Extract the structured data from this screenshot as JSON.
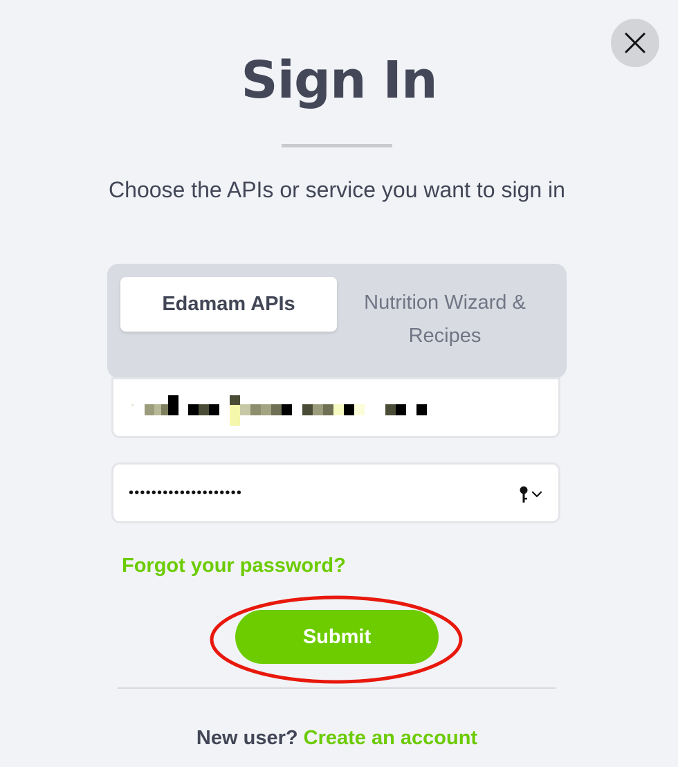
{
  "dialog": {
    "close_icon": "close-icon",
    "title": "Sign In",
    "subtitle": "Choose the APIs or service you want to sign in"
  },
  "tabs": {
    "active_label": "Edamam APIs",
    "inactive_label": "Nutrition Wizard & Recipes"
  },
  "form": {
    "email_value": "",
    "password_masked": "••••••••••••••••••••",
    "password_icon": "key-icon",
    "password_dropdown_icon": "chevron-down-icon",
    "forgot_label": "Forgot your password?",
    "submit_label": "Submit"
  },
  "footer": {
    "prompt": "New user?",
    "link_label": "Create an account"
  },
  "colors": {
    "accent": "#6dcc00",
    "text": "#424656",
    "background": "#f1f3f7",
    "highlight": "#e8180c"
  }
}
